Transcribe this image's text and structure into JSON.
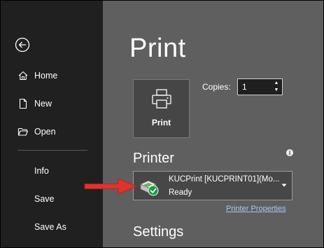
{
  "sidebar": {
    "back_icon": "back-arrow-circle-icon",
    "items": [
      {
        "label": "Home",
        "icon": "home-icon"
      },
      {
        "label": "New",
        "icon": "new-document-icon"
      },
      {
        "label": "Open",
        "icon": "open-folder-icon"
      },
      {
        "label": "Info"
      },
      {
        "label": "Save"
      },
      {
        "label": "Save As"
      }
    ]
  },
  "main": {
    "title": "Print",
    "print_button_label": "Print",
    "copies": {
      "label": "Copies:",
      "value": "1"
    },
    "printer_section": {
      "heading": "Printer",
      "selected_printer": "KUCPrint [KUCPRINT01](Mo...",
      "status": "Ready",
      "properties_link": "Printer Properties"
    },
    "settings_section": {
      "heading": "Settings"
    }
  },
  "colors": {
    "sidebar_bg": "#202020",
    "main_bg": "#5f5f5f",
    "arrow": "#e0332e",
    "ready_check": "#1a9e3f",
    "link": "#a7c8ef"
  }
}
